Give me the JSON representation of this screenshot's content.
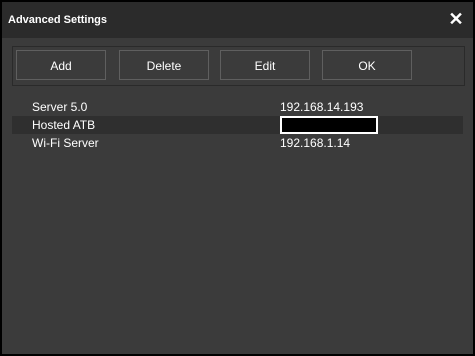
{
  "window": {
    "title": "Advanced Settings",
    "close_glyph": "✕"
  },
  "toolbar": {
    "add_label": "Add",
    "delete_label": "Delete",
    "edit_label": "Edit",
    "ok_label": "OK"
  },
  "servers": [
    {
      "name": "Server 5.0",
      "address": "192.168.14.193"
    },
    {
      "name": "Hosted ATB",
      "address": ""
    },
    {
      "name": "Wi-Fi Server",
      "address": "192.168.1.14"
    }
  ],
  "colors": {
    "background": "#3b3b3b",
    "titlebar": "#2b2b2b",
    "text": "#ffffff",
    "alt_row": "#2f2f2f"
  }
}
